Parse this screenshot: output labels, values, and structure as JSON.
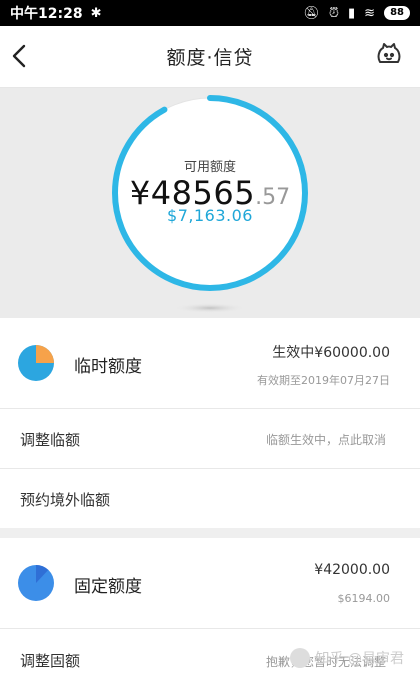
{
  "status_bar": {
    "time": "中午12:28",
    "battery": "88"
  },
  "nav": {
    "title": "额度·信贷"
  },
  "hero": {
    "label": "可用额度",
    "amount_main": "¥48565",
    "amount_cents": ".57",
    "usd": "$7,163.06",
    "progress": 0.92,
    "ring_color": "#2eb7e6"
  },
  "temp_quota": {
    "title": "临时额度",
    "status_amount": "生效中¥60000.00",
    "validity": "有效期至2019年07月27日",
    "pie_fraction": 0.25,
    "pie_color": "#f6a24a"
  },
  "rows": {
    "adjust_temp": {
      "label": "调整临额",
      "hint": "临额生效中，点此取消"
    },
    "reserve_overseas": {
      "label": "预约境外临额"
    },
    "adjust_fixed": {
      "label": "调整固额",
      "hint": "抱歉，您暂时无法调整"
    }
  },
  "fixed_quota": {
    "title": "固定额度",
    "amount": "¥42000.00",
    "usd": "$6194.00",
    "pie_fraction": 0.12,
    "pie_color": "#2f6fd6"
  },
  "watermark": {
    "text": "知乎 @易审君"
  }
}
